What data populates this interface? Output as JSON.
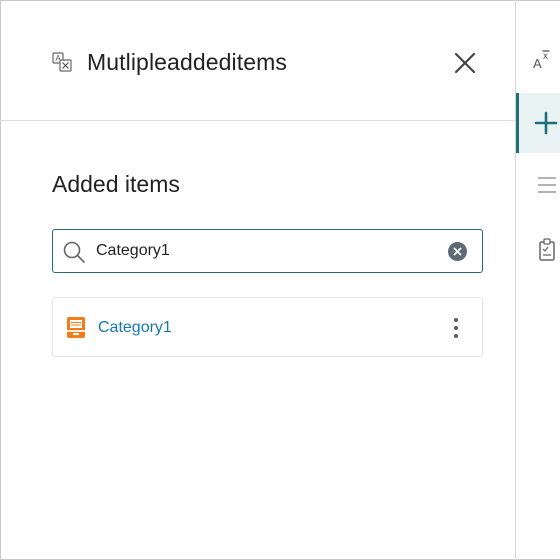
{
  "panel": {
    "title": "Mutlipleaddeditems",
    "header_icon": "translate-icon",
    "close_icon": "close-icon"
  },
  "section": {
    "title": "Added items"
  },
  "search": {
    "value": "Category1",
    "placeholder": "",
    "icon": "search-icon",
    "clear_icon": "clear-icon"
  },
  "results": [
    {
      "label": "Category1",
      "icon": "archive-box-icon",
      "menu_icon": "more-vertical-icon"
    }
  ],
  "rail": {
    "items": [
      {
        "name": "text-format-icon"
      },
      {
        "name": "add-icon",
        "active": true
      },
      {
        "name": "list-icon"
      },
      {
        "name": "clipboard-icon"
      }
    ]
  },
  "colors": {
    "accent": "#1f6f7a",
    "link": "#1777b0",
    "item_icon": "#f07c1a",
    "clear_button": "#5f6b74"
  }
}
